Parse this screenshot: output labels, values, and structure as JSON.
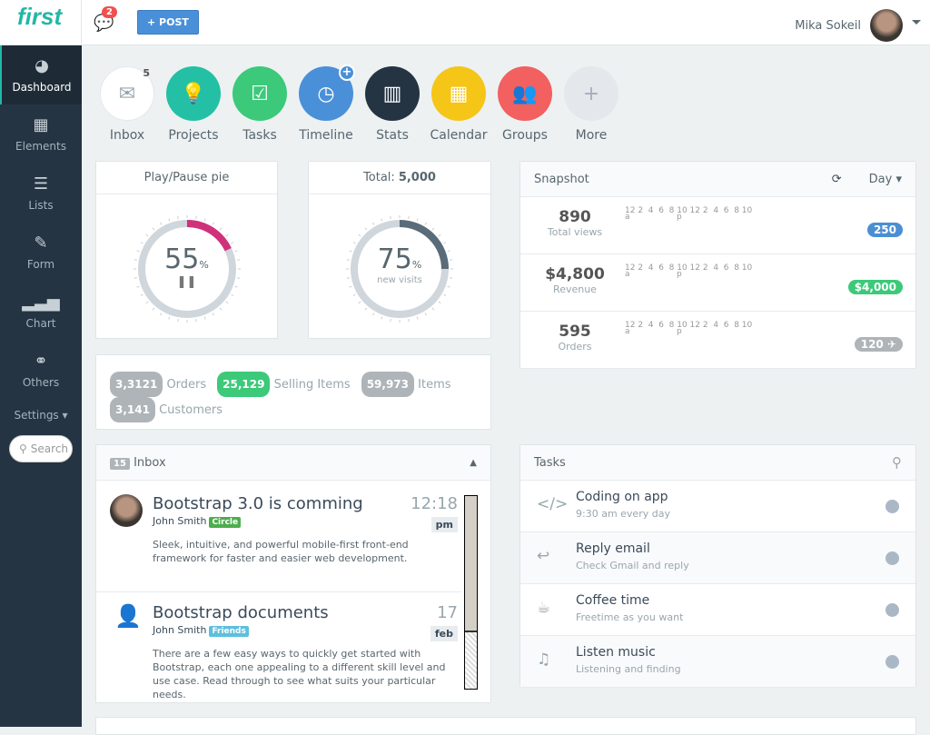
{
  "header": {
    "logo": "first",
    "chat_count": "2",
    "post_label": "+ POST",
    "user_name": "Mika Sokeil"
  },
  "sidebar": {
    "items": [
      {
        "label": "Dashboard",
        "icon": "dashboard-icon",
        "glyph": "◕"
      },
      {
        "label": "Elements",
        "icon": "grid-icon",
        "glyph": "▦"
      },
      {
        "label": "Lists",
        "icon": "list-icon",
        "glyph": "☰"
      },
      {
        "label": "Form",
        "icon": "edit-icon",
        "glyph": "✎"
      },
      {
        "label": "Chart",
        "icon": "signal-icon",
        "glyph": "▂▃▅"
      },
      {
        "label": "Others",
        "icon": "link-icon",
        "glyph": "⚭"
      }
    ],
    "settings": "Settings ▾",
    "search_placeholder": "Search"
  },
  "shortcuts": [
    {
      "label": "Inbox",
      "glyph": "✉",
      "color": "#ffffff",
      "badge": "5"
    },
    {
      "label": "Projects",
      "glyph": "💡",
      "color": "#23c0a5"
    },
    {
      "label": "Tasks",
      "glyph": "☑",
      "color": "#3cc97a"
    },
    {
      "label": "Timeline",
      "glyph": "◷",
      "color": "#4a90d9"
    },
    {
      "label": "Stats",
      "glyph": "▥",
      "color": "#253443"
    },
    {
      "label": "Calendar",
      "glyph": "▦",
      "color": "#f5c518"
    },
    {
      "label": "Groups",
      "glyph": "👥",
      "color": "#f26060"
    },
    {
      "label": "More",
      "glyph": "+",
      "color": "#e4e8ec"
    }
  ],
  "pie1": {
    "title": "Play/Pause pie",
    "value": "55",
    "unit": "%",
    "color": "#d0317a"
  },
  "pie2": {
    "title_prefix": "Total:",
    "title_value": "5,000",
    "value": "75",
    "unit": "%",
    "sub": "new visits",
    "color": "#5a6b7a"
  },
  "snapshot": {
    "title": "Snapshot",
    "range": "Day ▾",
    "ticks_top": "12 2  4  6  8 10 12 2  4  6  8 10",
    "ticks_bottom": "a                  p",
    "rows": [
      {
        "value": "890",
        "label": "Total views",
        "badge": "250",
        "color": "#4a8fd4"
      },
      {
        "value": "$4,800",
        "label": "Revenue",
        "badge": "$4,000",
        "color": "#3cc97a"
      },
      {
        "value": "595",
        "label": "Orders",
        "badge": "120 ✈",
        "color": "#aeb4b8"
      }
    ]
  },
  "stats": [
    {
      "value": "3,3121",
      "label": "Orders",
      "color": "#aeb4b8"
    },
    {
      "value": "25,129",
      "label": "Selling Items",
      "color": "#3cc97a"
    },
    {
      "value": "59,973",
      "label": "Items",
      "color": "#aeb4b8"
    },
    {
      "value": "3,141",
      "label": "Customers",
      "color": "#aeb4b8"
    }
  ],
  "inbox": {
    "count": "15",
    "title": "Inbox",
    "messages": [
      {
        "title": "Bootstrap 3.0 is comming",
        "author": "John Smith",
        "tag": "Circle",
        "tag_color": "#4cae4c",
        "time": "12:18",
        "time_sub": "pm",
        "body": "Sleek, intuitive, and powerful mobile-first front-end framework for faster and easier web development."
      },
      {
        "title": "Bootstrap documents",
        "author": "John Smith",
        "tag": "Friends",
        "tag_color": "#5bc0de",
        "time": "17",
        "time_sub": "feb",
        "body": "There are a few easy ways to quickly get started with Bootstrap, each one appealing to a different skill level and use case. Read through to see what suits your particular needs."
      }
    ]
  },
  "tasks": {
    "title": "Tasks",
    "items": [
      {
        "title": "Coding on app",
        "sub": "9:30 am every day",
        "glyph": "</>"
      },
      {
        "title": "Reply email",
        "sub": "Check Gmail and reply",
        "glyph": "↩"
      },
      {
        "title": "Coffee time",
        "sub": "Freetime as you want",
        "glyph": "☕"
      },
      {
        "title": "Listen music",
        "sub": "Listening and finding",
        "glyph": "♫"
      }
    ]
  }
}
